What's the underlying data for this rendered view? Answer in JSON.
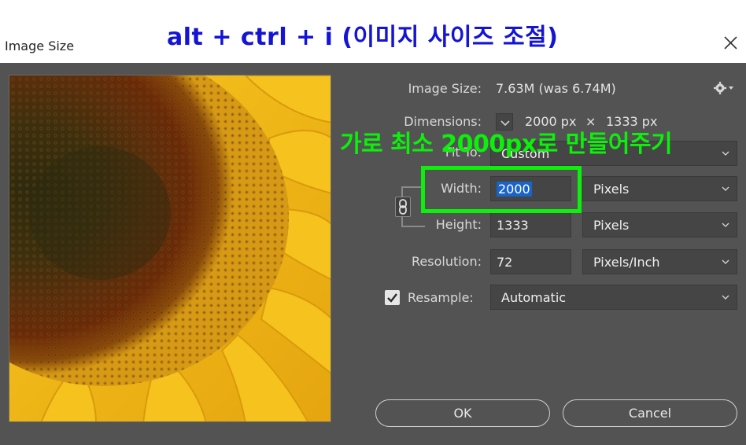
{
  "window": {
    "title": "Image Size"
  },
  "overlay": {
    "shortcut_title": "alt + ctrl + i (이미지 사이즈 조절)",
    "note": "가로 최소 2000px로 만들어주기",
    "highlight_color": "#0cf00c",
    "title_color": "#1414d4"
  },
  "info": {
    "image_size_label": "Image Size:",
    "image_size_value": "7.63M (was 6.74M)",
    "dimensions_label": "Dimensions:",
    "dimensions_w": "2000 px",
    "dimensions_x": "×",
    "dimensions_h": "1333 px"
  },
  "fit_to": {
    "label": "Fit To:",
    "value": "Custom"
  },
  "width": {
    "label": "Width:",
    "value": "2000",
    "unit": "Pixels"
  },
  "height": {
    "label": "Height:",
    "value": "1333",
    "unit": "Pixels"
  },
  "resolution": {
    "label": "Resolution:",
    "value": "72",
    "unit": "Pixels/Inch"
  },
  "resample": {
    "label": "Resample:",
    "checked": true,
    "value": "Automatic"
  },
  "buttons": {
    "ok": "OK",
    "cancel": "Cancel"
  },
  "icons": {
    "close": "close-icon",
    "gear": "gear-icon",
    "link": "link-icon",
    "chevron": "chevron-down-icon",
    "check": "checkmark-icon"
  }
}
